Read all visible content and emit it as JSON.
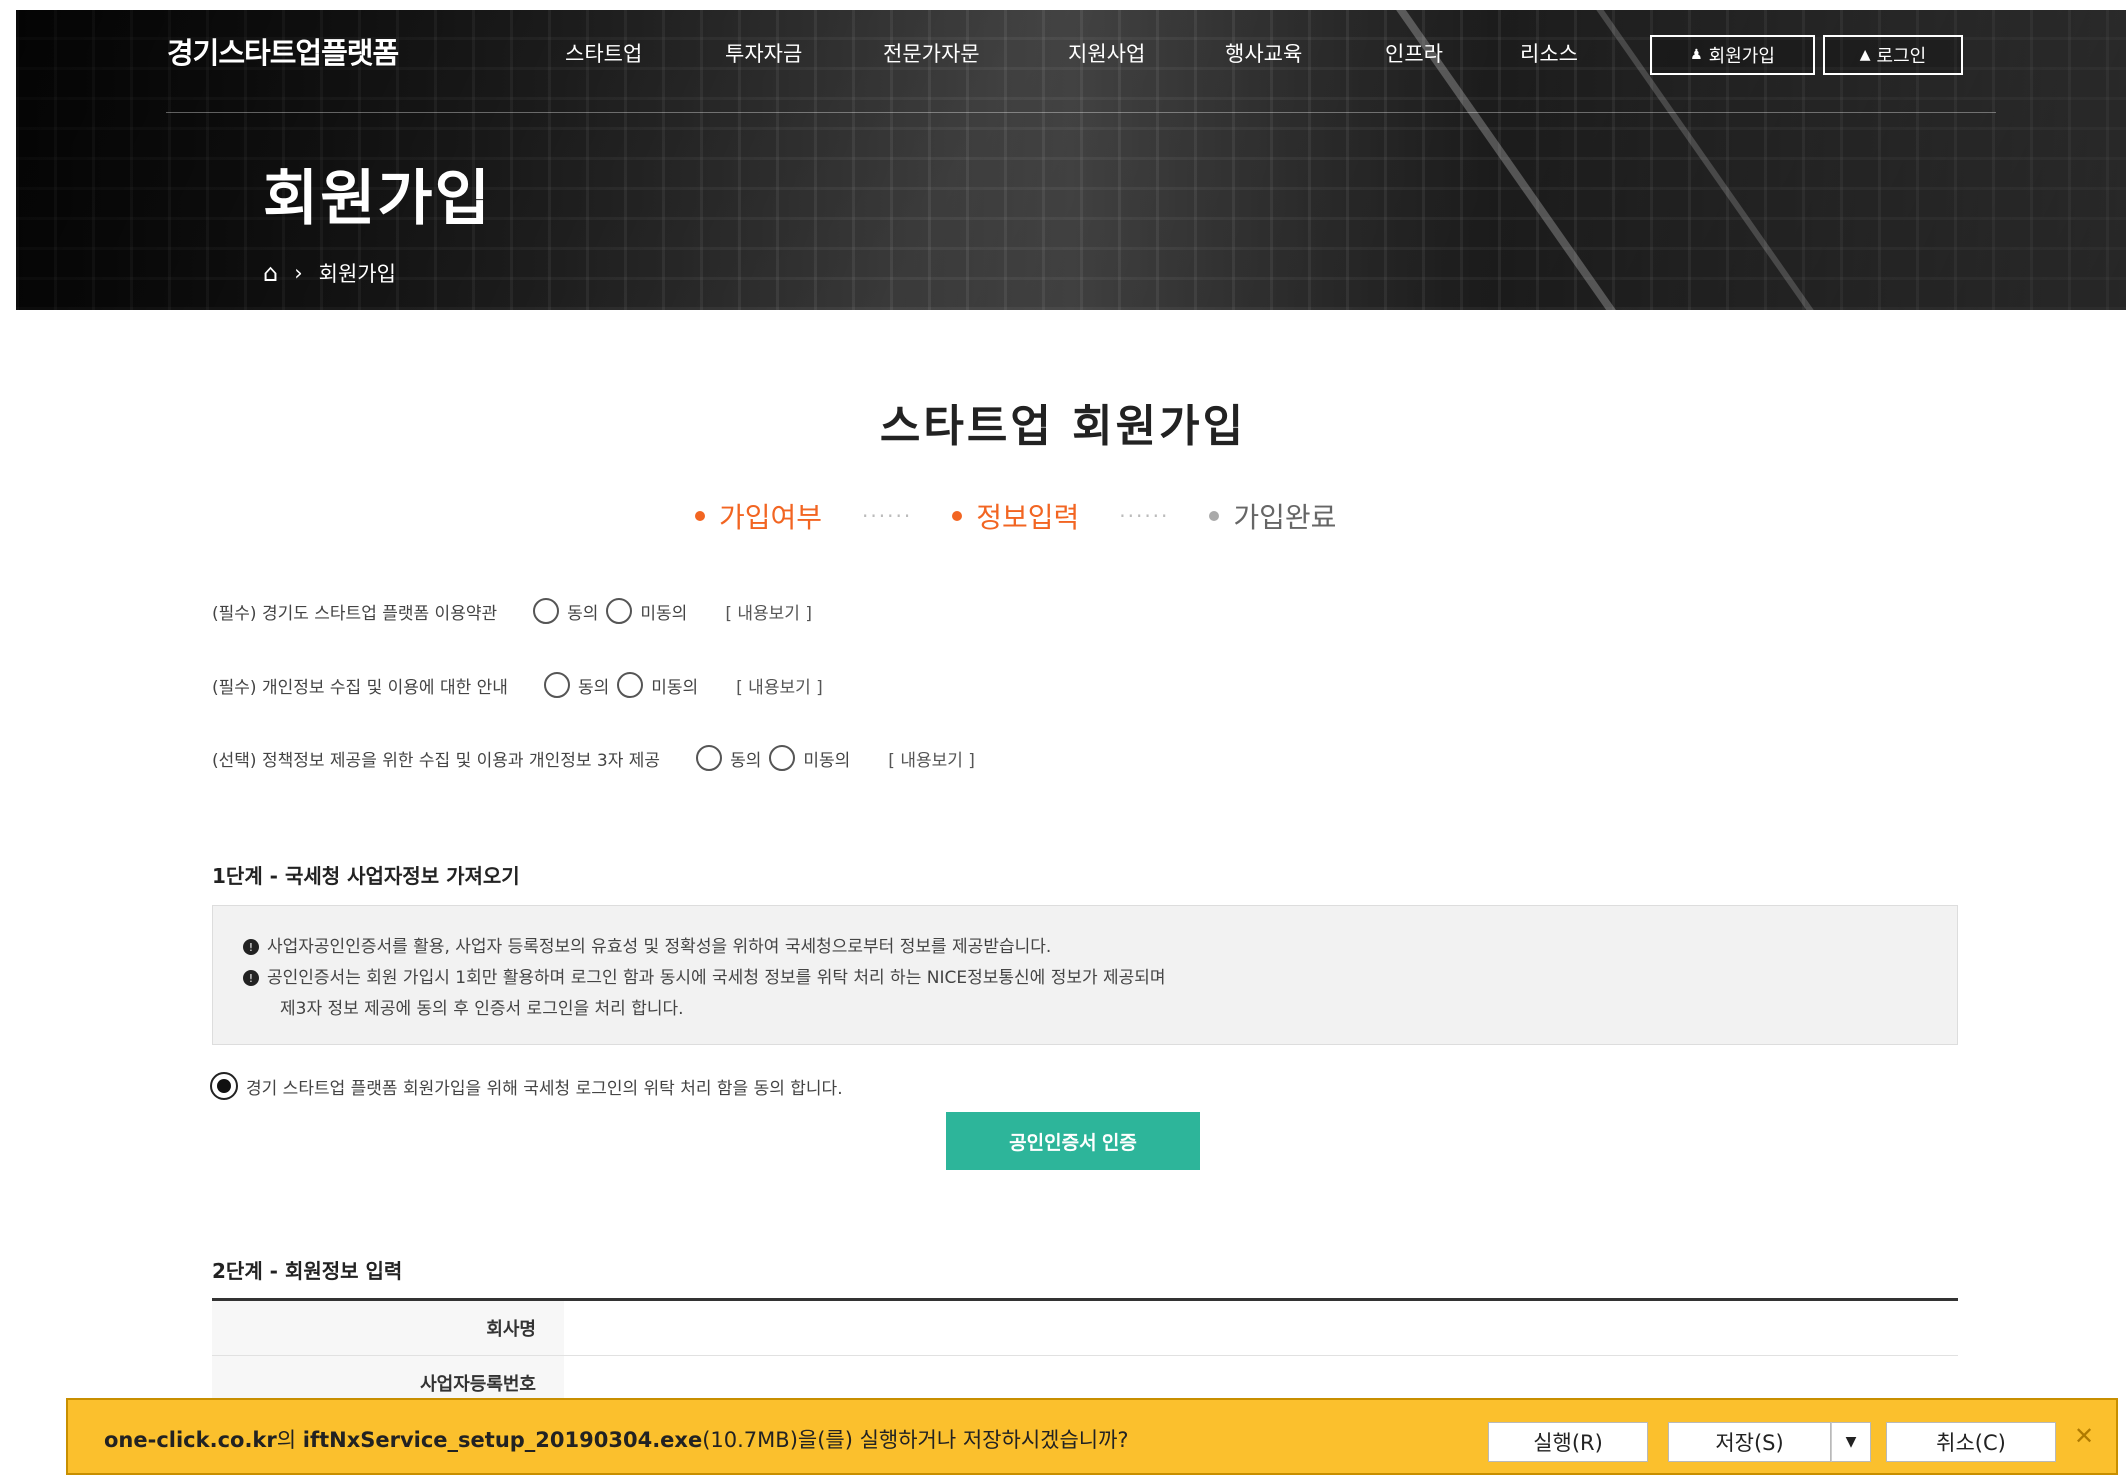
{
  "header": {
    "logo": "경기스타트업플랫폼",
    "nav": [
      "스타트업",
      "투자자금",
      "전문가자문",
      "지원사업",
      "행사교육",
      "인프라",
      "리소스"
    ],
    "join_label": "회원가입",
    "login_label": "로그인"
  },
  "hero": {
    "title": "회원가입",
    "breadcrumb_current": "회원가입"
  },
  "main": {
    "title": "스타트업 회원가입",
    "steps": [
      {
        "label": "가입여부",
        "state": "active"
      },
      {
        "label": "정보입력",
        "state": "active"
      },
      {
        "label": "가입완료",
        "state": "inactive"
      }
    ],
    "step_sep": "······",
    "agreements": [
      {
        "label": "(필수) 경기도 스타트업 플랫폼 이용약관",
        "agree": "동의",
        "disagree": "미동의",
        "more": "[ 내용보기 ]"
      },
      {
        "label": "(필수) 개인정보 수집 및 이용에 대한 안내",
        "agree": "동의",
        "disagree": "미동의",
        "more": "[ 내용보기 ]"
      },
      {
        "label": "(선택) 정책정보 제공을 위한 수집 및 이용과 개인정보 3자 제공",
        "agree": "동의",
        "disagree": "미동의",
        "more": "[ 내용보기 ]"
      }
    ],
    "step1": {
      "heading": "1단계 - 국세청 사업자정보 가져오기",
      "info_lines": [
        "사업자공인인증서를 활용, 사업자 등록정보의 유효성 및 정확성을 위하여 국세청으로부터 정보를 제공받습니다.",
        "공인인증서는 회원 가입시 1회만 활용하며 로그인 함과 동시에 국세청 정보를 위탁 처리 하는 NICE정보통신에 정보가 제공되며",
        "제3자 정보 제공에 동의 후 인증서 로그인을 처리 합니다."
      ],
      "consent": "경기 스타트업 플랫폼 회원가입을 위해 국세청 로그인의 위탁 처리 함을 동의 합니다.",
      "cert_button": "공인인증서 인증"
    },
    "step2": {
      "heading": "2단계 - 회원정보 입력",
      "fields": [
        "회사명",
        "사업자등록번호"
      ]
    }
  },
  "download_bar": {
    "site": "one-click.co.kr",
    "particle": "의 ",
    "filename": "iftNxService_setup_20190304.exe",
    "size": "(10.7MB)",
    "message": "을(를) 실행하거나 저장하시겠습니까?",
    "run": "실행(R)",
    "save": "저장(S)",
    "cancel": "취소(C)"
  },
  "colors": {
    "accent_orange": "#f26522",
    "button_green": "#2db59a",
    "download_bar": "#fbc02d"
  }
}
